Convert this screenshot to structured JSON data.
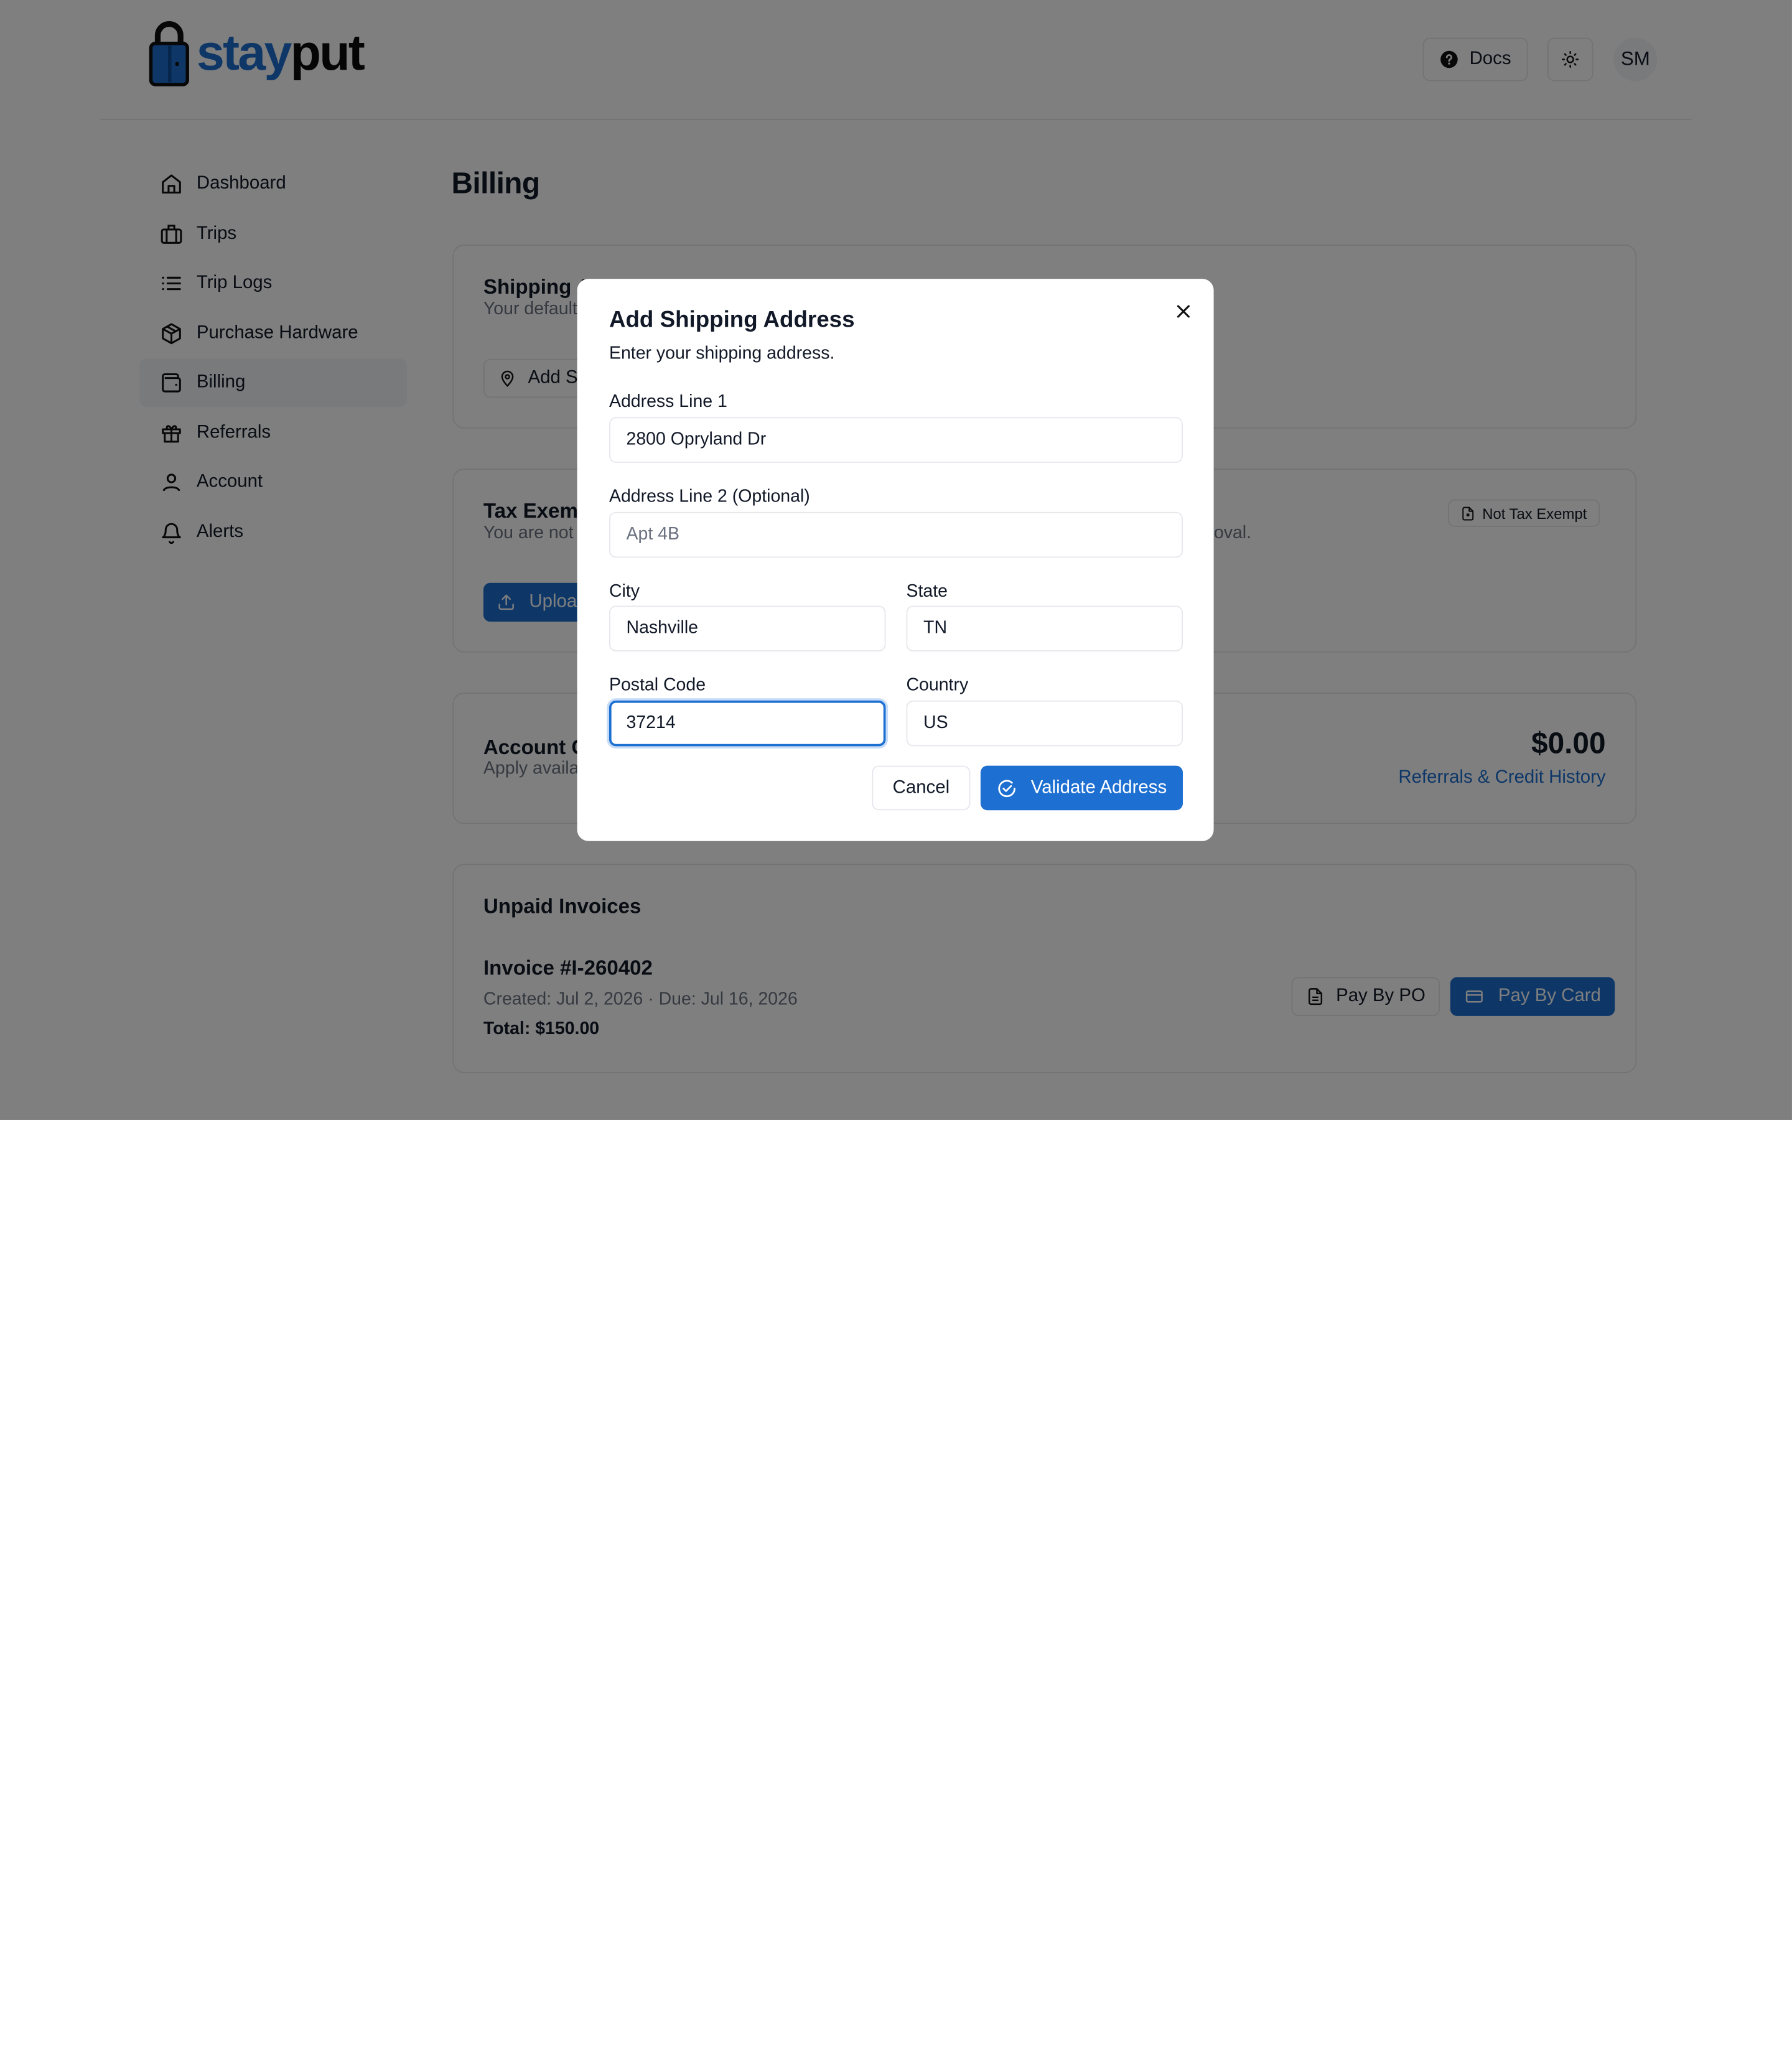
{
  "app": {
    "logo": {
      "part1": "stay",
      "part2": "put"
    },
    "header": {
      "docs_label": "Docs",
      "user_initials": "SM"
    }
  },
  "sidebar": {
    "items": [
      {
        "label": "Dashboard",
        "icon": "home-icon"
      },
      {
        "label": "Trips",
        "icon": "luggage-icon"
      },
      {
        "label": "Trip Logs",
        "icon": "list-icon"
      },
      {
        "label": "Purchase Hardware",
        "icon": "package-icon"
      },
      {
        "label": "Billing",
        "icon": "wallet-icon",
        "active": true
      },
      {
        "label": "Referrals",
        "icon": "gift-icon"
      },
      {
        "label": "Account",
        "icon": "user-icon"
      },
      {
        "label": "Alerts",
        "icon": "bell-icon"
      }
    ]
  },
  "main": {
    "title": "Billing",
    "shipping": {
      "title": "Shipping A",
      "subtitle": "Your default",
      "button": "Add S"
    },
    "tax": {
      "title": "Tax Exemp",
      "subtitle": "You are not",
      "subtitle_tail": "roval.",
      "badge": "Not Tax Exempt",
      "button": "Uploa"
    },
    "credit": {
      "title": "Account C",
      "subtitle": "Apply availa",
      "amount": "$0.00",
      "link": "Referrals & Credit History"
    },
    "invoices": {
      "title": "Unpaid Invoices",
      "invoice_number": "Invoice #I-260402",
      "dates": "Created: Jul 2, 2026 · Due: Jul 16, 2026",
      "total": "Total: $150.00",
      "pay_po": "Pay By PO",
      "pay_card": "Pay By Card"
    }
  },
  "modal": {
    "title": "Add Shipping Address",
    "subtitle": "Enter your shipping address.",
    "fields": {
      "address1": {
        "label": "Address Line 1",
        "value": "2800 Opryland Dr"
      },
      "address2": {
        "label": "Address Line 2 (Optional)",
        "value": "",
        "placeholder": "Apt 4B"
      },
      "city": {
        "label": "City",
        "value": "Nashville"
      },
      "state": {
        "label": "State",
        "value": "TN"
      },
      "postal": {
        "label": "Postal Code",
        "value": "37214"
      },
      "country": {
        "label": "Country",
        "value": "US"
      }
    },
    "cancel": "Cancel",
    "validate": "Validate Address"
  },
  "colors": {
    "brand": "#1d6fd1",
    "overlay": "rgba(0,0,0,0.5)"
  }
}
